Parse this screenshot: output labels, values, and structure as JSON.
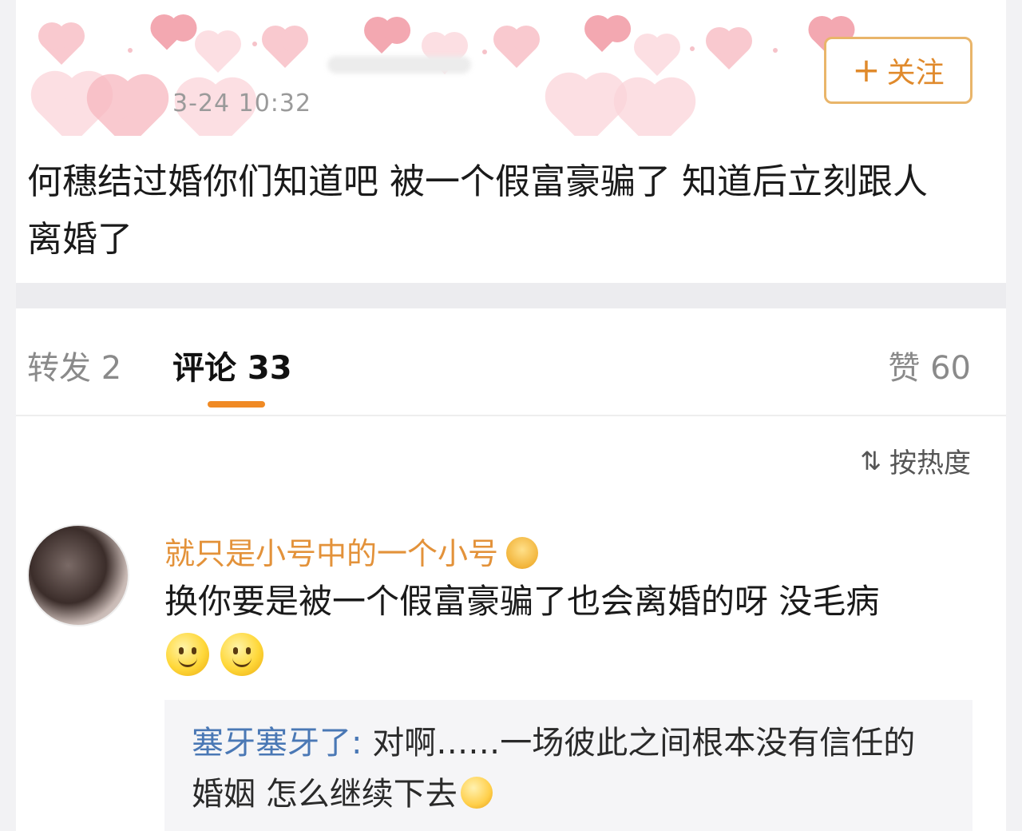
{
  "post": {
    "timestamp": "3-24 10:32",
    "follow_label": "关注",
    "text": "何穗结过婚你们知道吧  被一个假富豪骗了  知道后立刻跟人离婚了"
  },
  "tabs": {
    "repost": "转发 2",
    "comments": "评论 33",
    "likes": "赞 60"
  },
  "sort": {
    "icon": "sort-icon",
    "label": "按热度"
  },
  "comment": {
    "author": "就只是小号中的一个小号",
    "text": "换你要是被一个假富豪骗了也会离婚的呀 没毛病",
    "emojis": [
      "smile-emoji",
      "smile-emoji"
    ],
    "reply": {
      "author": "塞牙塞牙了:",
      "text": " 对啊……一场彼此之间根本没有信任的婚姻 怎么继续下去"
    }
  },
  "colors": {
    "accent": "#f08a24",
    "follow_text": "#e08a2c",
    "follow_border": "#e9b56a",
    "username": "#e3923a",
    "reply_name": "#4a78b5"
  }
}
